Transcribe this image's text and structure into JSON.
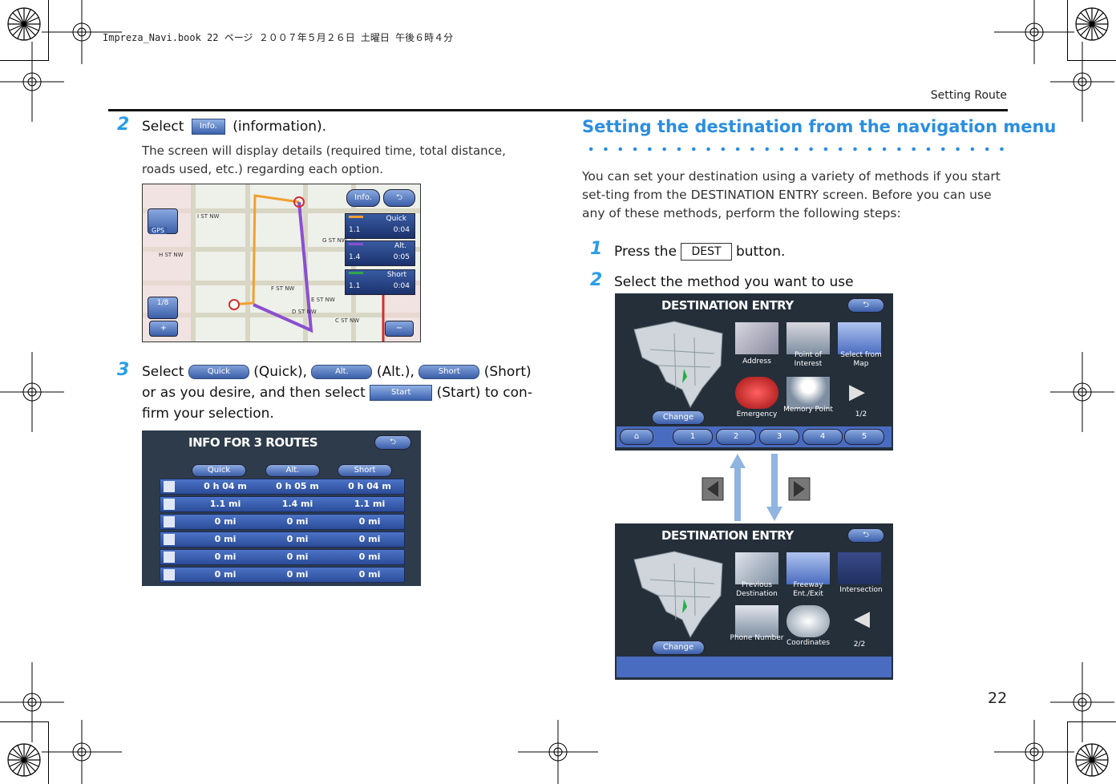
{
  "header": {
    "file_line": "Impreza_Navi.book  22 ページ  ２００７年５月２６日  土曜日  午後６時４分",
    "running_head": "Setting Route",
    "page_number": "22"
  },
  "left_column": {
    "step2": {
      "number": "2",
      "text_before": "Select",
      "button_label": "Info.",
      "text_after": "(information).",
      "description": "The screen will display details (required time, total distance, roads used, etc.) regarding each option."
    },
    "map_screen": {
      "info_button": "Info.",
      "routes": [
        {
          "name": "Quick",
          "distance": "1.1",
          "time": "0:04"
        },
        {
          "name": "Alt.",
          "distance": "1.4",
          "time": "0:05"
        },
        {
          "name": "Short",
          "distance": "1.1",
          "time": "0:04"
        }
      ],
      "gps_label": "GPS",
      "scale_label": "1/8",
      "street_labels": [
        "I ST NW",
        "H ST NW",
        "F ST NW",
        "E ST NW",
        "C ST NW",
        "G ST NW",
        "D ST NW"
      ]
    },
    "step3": {
      "number": "3",
      "text_select": "Select",
      "quick_btn": "Quick",
      "quick_txt": "(Quick),",
      "alt_btn": "Alt.",
      "alt_txt": "(Alt.),",
      "short_btn": "Short",
      "short_txt": "(Short)",
      "line2_before": "or as you desire, and then select",
      "start_btn": "Start",
      "line2_after": "(Start) to con-",
      "line3": "firm your selection."
    },
    "routes_table": {
      "title": "INFO FOR 3 ROUTES",
      "columns": [
        "Quick",
        "Alt.",
        "Short"
      ],
      "rows": [
        [
          "0 h 04 m",
          "0 h 05 m",
          "0 h 04 m"
        ],
        [
          "1.1 mi",
          "1.4 mi",
          "1.1 mi"
        ],
        [
          "0 mi",
          "0 mi",
          "0 mi"
        ],
        [
          "0 mi",
          "0 mi",
          "0 mi"
        ],
        [
          "0 mi",
          "0 mi",
          "0 mi"
        ],
        [
          "0 mi",
          "0 mi",
          "0 mi"
        ]
      ]
    }
  },
  "right_column": {
    "heading": "Setting the destination from the navigation menu",
    "intro": "You can set your destination using a variety of methods if you start set-ting from the DESTINATION ENTRY screen. Before you can use any of these methods, perform the following steps:",
    "step1": {
      "number": "1",
      "text_before": "Press the",
      "button": "DEST",
      "text_after": "button."
    },
    "step2": {
      "number": "2",
      "text": "Select the method you want to use"
    },
    "screen1": {
      "title": "DESTINATION ENTRY",
      "change": "Change",
      "items": [
        "Address",
        "Point of Interest",
        "Select from Map",
        "Emergency",
        "Memory Point",
        "1/2"
      ],
      "tabs": [
        "1",
        "2",
        "3",
        "4",
        "5"
      ]
    },
    "screen2": {
      "title": "DESTINATION ENTRY",
      "change": "Change",
      "items": [
        "Previous Destination",
        "Freeway Ent./Exit",
        "Intersection",
        "Phone Number",
        "Coordinates",
        "2/2"
      ]
    }
  },
  "colors": {
    "accent": "#2a9de6",
    "heading": "#2a8ee0",
    "button_blue": "#3c5fa8"
  }
}
